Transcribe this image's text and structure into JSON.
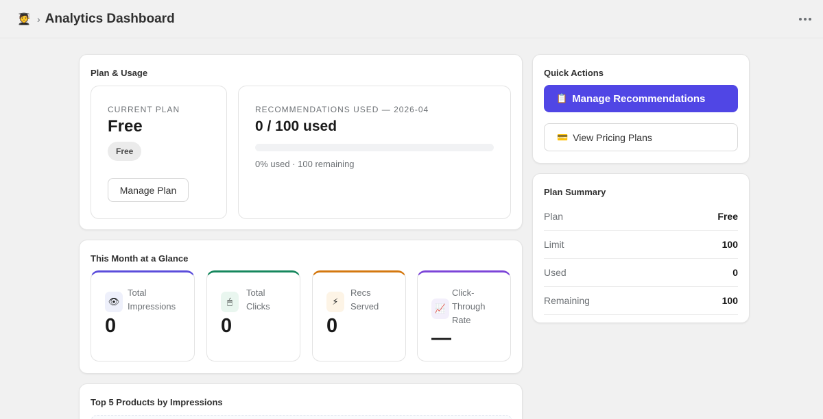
{
  "header": {
    "title": "Analytics Dashboard",
    "app_icon": "app-logo-emoji",
    "breadcrumb_separator": "›"
  },
  "plan_usage": {
    "title": "Plan & Usage",
    "current_plan": {
      "eyebrow": "CURRENT PLAN",
      "name": "Free",
      "badge": "Free",
      "manage_button": "Manage Plan"
    },
    "recommendations": {
      "eyebrow": "RECOMMENDATIONS USED — 2026-04",
      "headline": "0 / 100 used",
      "progress_fraction": 0,
      "caption": "0% used · 100 remaining"
    }
  },
  "glance": {
    "title": "This Month at a Glance",
    "stats": [
      {
        "label": "Total Impressions",
        "value": "0",
        "icon": "eye-icon",
        "accent": "#5b4ddb"
      },
      {
        "label": "Total Clicks",
        "value": "0",
        "icon": "mouse-icon",
        "accent": "#16875d"
      },
      {
        "label": "Recs Served",
        "value": "0",
        "icon": "lightning-icon",
        "accent": "#d4780f"
      },
      {
        "label": "Click-Through Rate",
        "value": "—",
        "icon": "chart-trend-icon",
        "accent": "#7c45d8"
      }
    ]
  },
  "top_products": {
    "title": "Top 5 Products by Impressions"
  },
  "quick_actions": {
    "title": "Quick Actions",
    "primary_label": "Manage Recommendations",
    "primary_icon": "clipboard-icon",
    "secondary_label": "View Pricing Plans",
    "secondary_icon": "credit-card-icon"
  },
  "plan_summary": {
    "title": "Plan Summary",
    "rows": [
      {
        "key": "Plan",
        "value": "Free"
      },
      {
        "key": "Limit",
        "value": "100"
      },
      {
        "key": "Used",
        "value": "0"
      },
      {
        "key": "Remaining",
        "value": "100"
      }
    ]
  },
  "colors": {
    "accent": "#5046e5",
    "background": "#f1f1f1"
  }
}
